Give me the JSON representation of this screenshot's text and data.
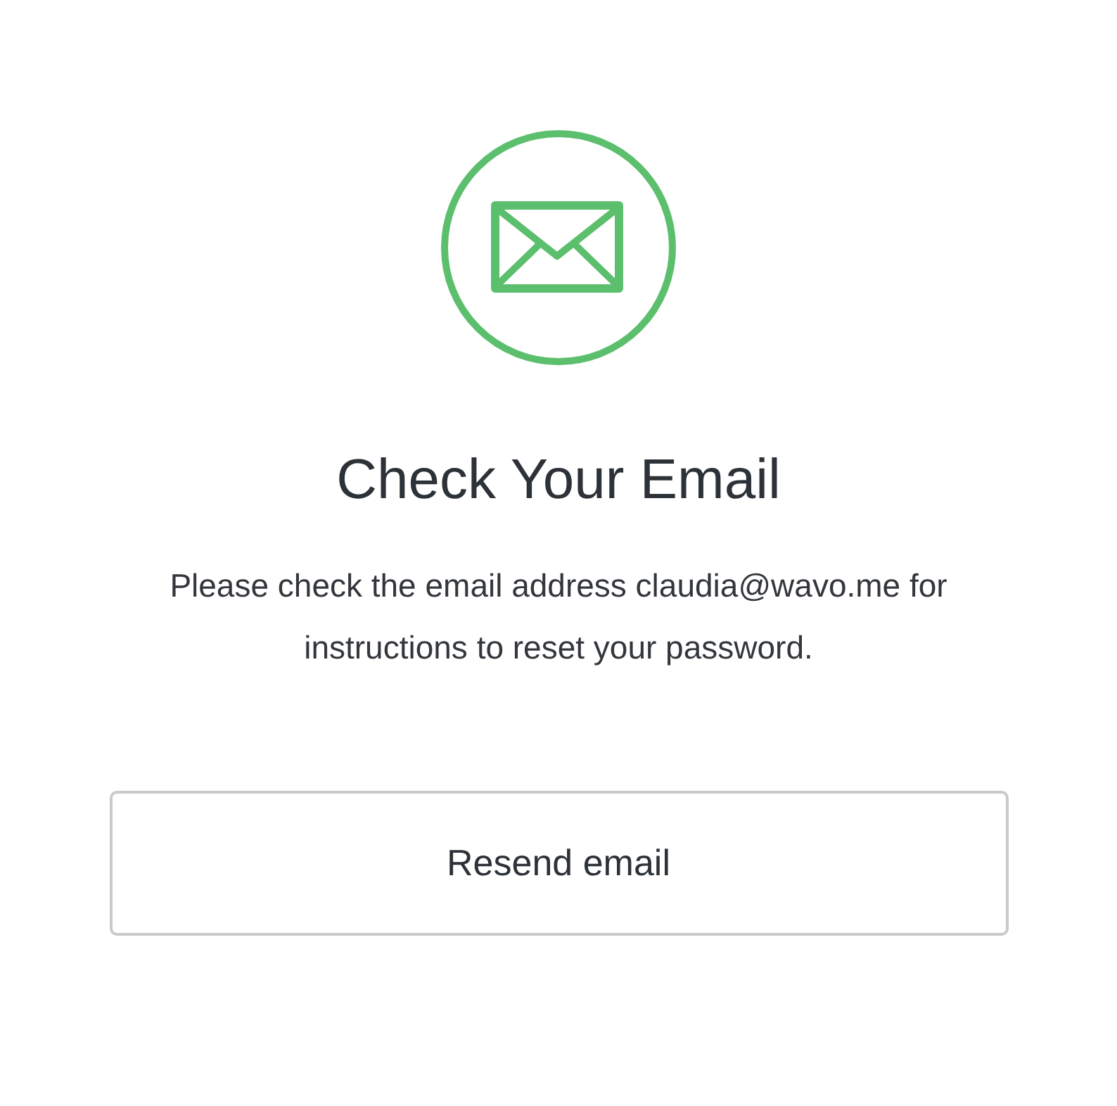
{
  "title": "Check Your Email",
  "message": "Please check the email address claudia@wavo.me for instructions to reset your password.",
  "button": "Resend email"
}
